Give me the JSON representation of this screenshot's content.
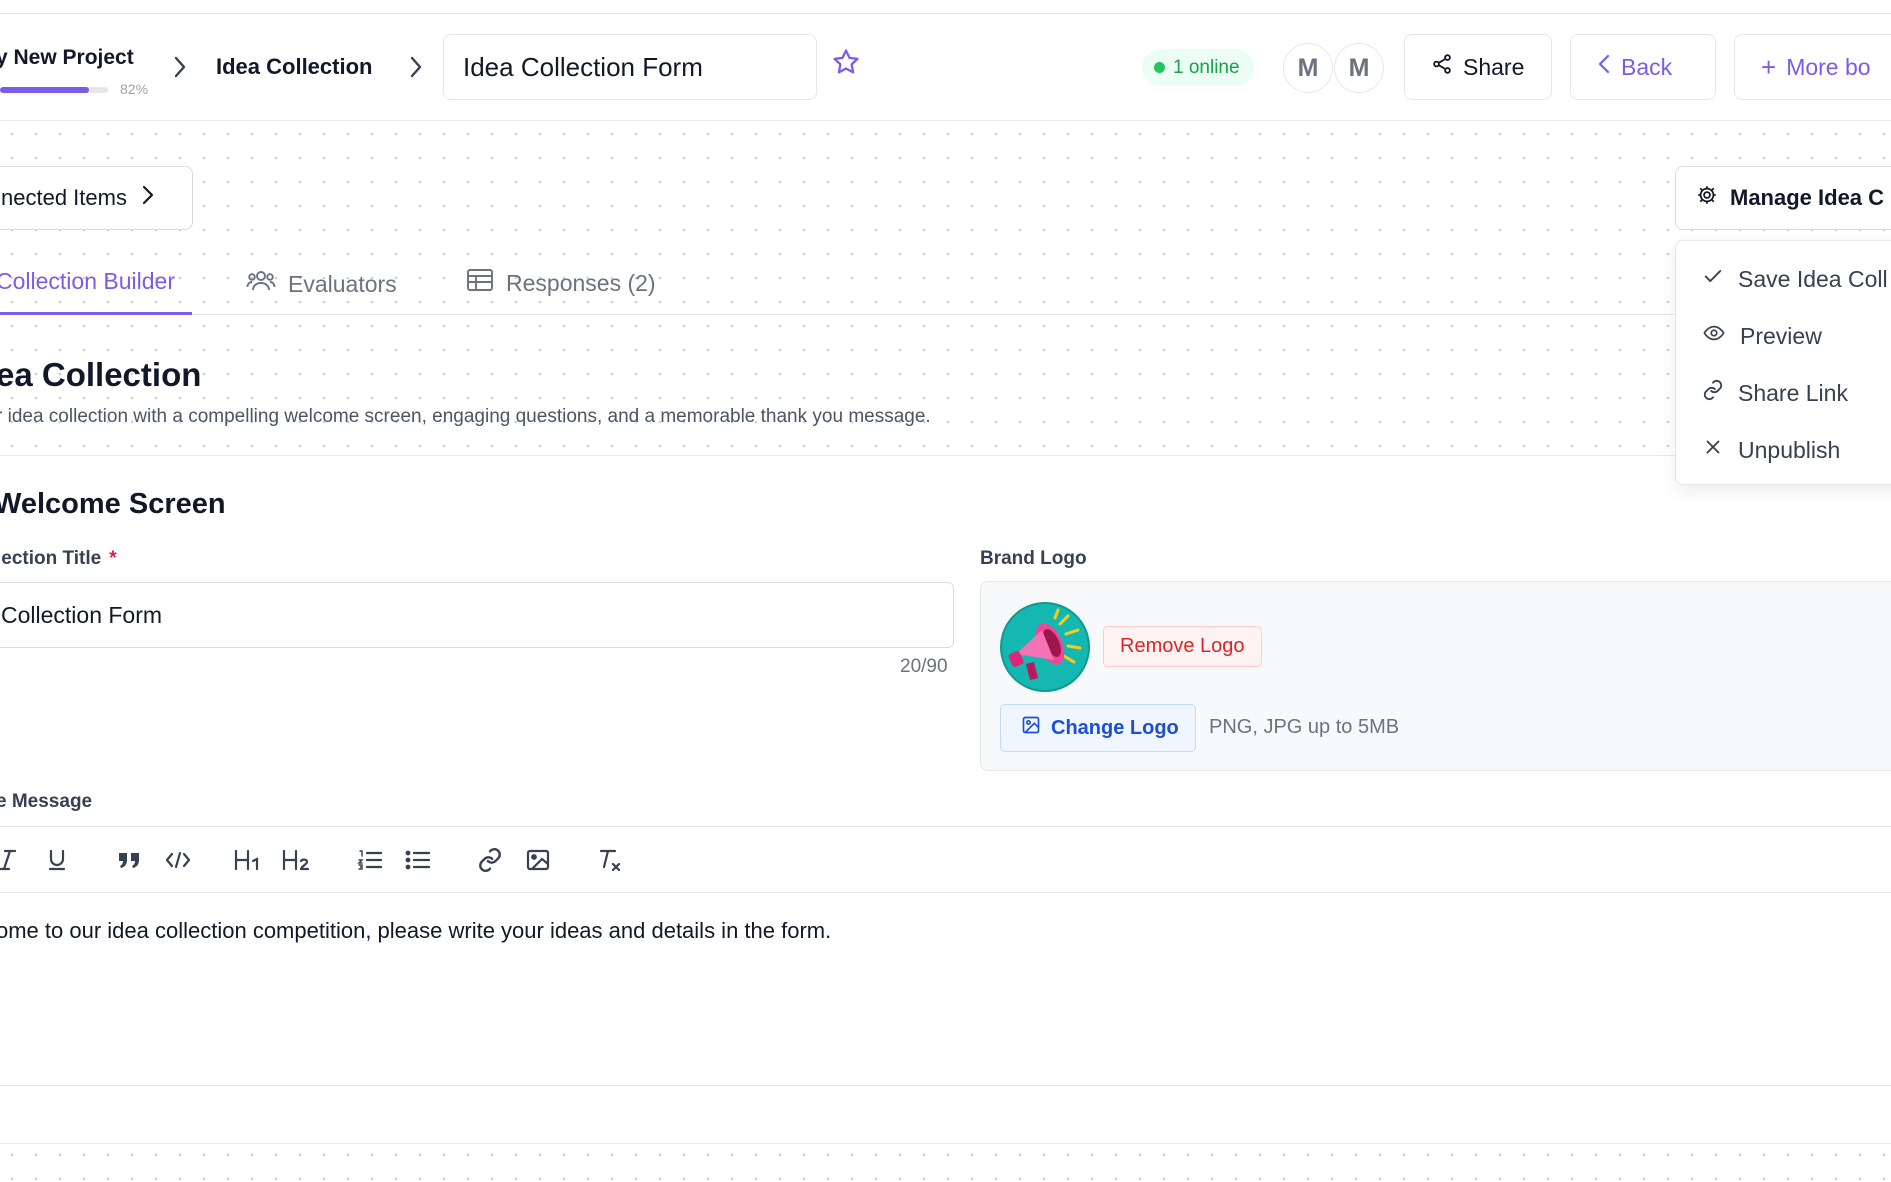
{
  "header": {
    "project_name": "y New Project",
    "progress_percent": 82,
    "progress_text": "82%",
    "breadcrumb_current": "Idea Collection",
    "form_title": "Idea Collection Form",
    "online_text": "1 online",
    "avatars": [
      "M",
      "M"
    ],
    "share_label": "Share",
    "back_label": "Back",
    "more_label": "More bo"
  },
  "toolbar_row": {
    "connected_label": "nected Items",
    "manage_label": "Manage Idea C"
  },
  "tabs": [
    {
      "label": "Collection Builder",
      "active": true
    },
    {
      "label": "Evaluators",
      "active": false
    },
    {
      "label": "Responses (2)",
      "active": false
    }
  ],
  "page": {
    "title": "ea Collection",
    "subtitle": "r idea collection with a compelling welcome screen, engaging questions, and a memorable thank you message."
  },
  "welcome": {
    "section_title": "Welcome Screen",
    "title_label": "lection Title",
    "title_required": "*",
    "title_value": "Collection Form",
    "title_counter": "20/90",
    "logo_label": "Brand Logo",
    "remove_logo_label": "Remove Logo",
    "change_logo_label": "Change Logo",
    "logo_hint": "PNG, JPG up to 5MB",
    "message_label": "e Message",
    "message_text": "ome to our idea collection competition, please write your ideas and details in the form."
  },
  "editor_tools": [
    "italic-icon",
    "underline-icon",
    "quote-icon",
    "code-icon",
    "heading1-icon",
    "heading2-icon",
    "ordered-list-icon",
    "bullet-list-icon",
    "link-icon",
    "image-icon",
    "clear-format-icon"
  ],
  "manage_menu": {
    "items": [
      {
        "label": "Save Idea Coll",
        "icon": "check-icon"
      },
      {
        "label": "Preview",
        "icon": "eye-icon"
      },
      {
        "label": "Share Link",
        "icon": "link-icon"
      },
      {
        "label": "Unpublish",
        "icon": "x-icon"
      }
    ]
  },
  "colors": {
    "accent": "#7c5ce6",
    "online_green": "#16a34a",
    "danger": "#dc2626",
    "info_blue": "#1d4ed8"
  }
}
